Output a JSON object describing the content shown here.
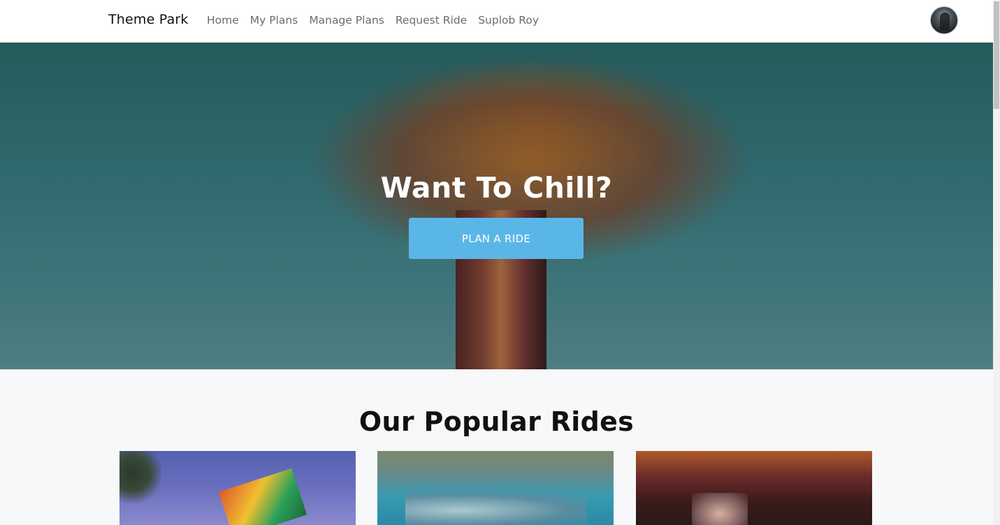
{
  "navbar": {
    "brand": "Theme Park",
    "links": [
      {
        "label": "Home"
      },
      {
        "label": "My Plans"
      },
      {
        "label": "Manage Plans"
      },
      {
        "label": "Request Ride"
      },
      {
        "label": "Suplob Roy"
      }
    ],
    "avatar_icon": "user-avatar"
  },
  "hero": {
    "title": "Want To Chill?",
    "button_label": "PLAN A RIDE",
    "button_color": "#5bb6e8"
  },
  "popular": {
    "title": "Our Popular Rides"
  }
}
